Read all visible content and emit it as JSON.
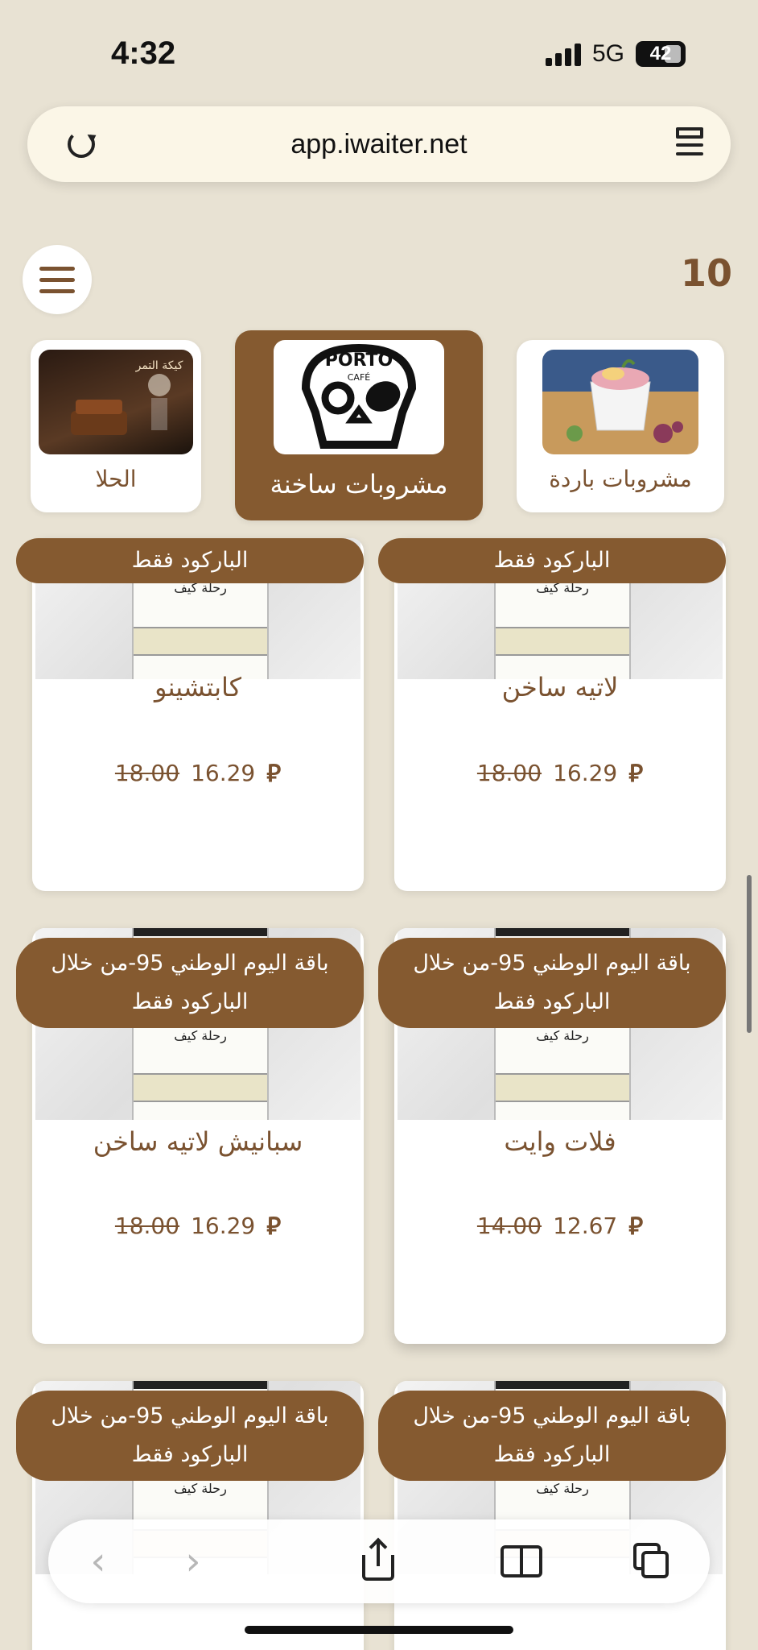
{
  "status_bar": {
    "time": "4:32",
    "network": "5G",
    "battery": "42"
  },
  "browser": {
    "url": "app.iwaiter.net"
  },
  "header": {
    "cart_count": "10"
  },
  "categories": [
    {
      "label": "مشروبات باردة",
      "active": false
    },
    {
      "label": "مشروبات ساخنة",
      "active": true,
      "logo_top": "PORTO",
      "logo_sub": "CAFÉ"
    },
    {
      "label": "الحلا",
      "active": false,
      "thumb_caption": "كيكة التمر"
    }
  ],
  "products": [
    {
      "name": "لاتيه ساخن",
      "price": "16.29",
      "old_price": "18.00",
      "badge": "الباركود فقط"
    },
    {
      "name": "كابتشينو",
      "price": "16.29",
      "old_price": "18.00",
      "badge": "الباركود فقط"
    },
    {
      "name": "فلات وايت",
      "price": "12.67",
      "old_price": "14.00",
      "badge": "باقة اليوم الوطني 95-من خلال الباركود فقط"
    },
    {
      "name": "سبانيش لاتيه ساخن",
      "price": "16.29",
      "old_price": "18.00",
      "badge": "باقة اليوم الوطني 95-من خلال الباركود فقط"
    },
    {
      "name": "",
      "price": "",
      "old_price": "",
      "badge": "باقة اليوم الوطني 95-من خلال الباركود فقط"
    },
    {
      "name": "",
      "price": "",
      "old_price": "",
      "badge": "باقة اليوم الوطني 95-من خلال الباركود فقط"
    }
  ],
  "cup_logo_text": "رحلة كيف",
  "currency_symbol": "⃁",
  "colors": {
    "accent": "#855a30",
    "background": "#e8e2d3",
    "card": "#ffffff"
  }
}
